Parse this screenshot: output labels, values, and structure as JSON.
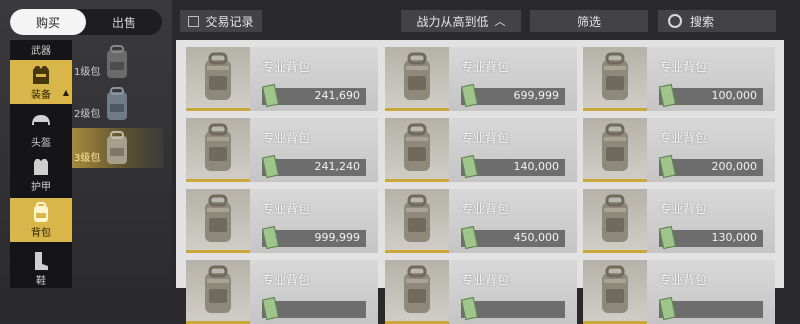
{
  "trade_tabs": [
    {
      "label": "购买",
      "active": true
    },
    {
      "label": "出售",
      "active": false
    }
  ],
  "categories": [
    {
      "label": "武器",
      "icon": "rifle-icon"
    },
    {
      "label": "装备",
      "icon": "vest-icon",
      "active": true
    },
    {
      "label": "头盔",
      "icon": "helmet-icon"
    },
    {
      "label": "护甲",
      "icon": "armor-icon"
    },
    {
      "label": "背包",
      "icon": "backpack-icon",
      "highlighted": true
    },
    {
      "label": "鞋",
      "icon": "boots-icon"
    }
  ],
  "levels": [
    {
      "label": "1级包",
      "selected": false
    },
    {
      "label": "2级包",
      "selected": false
    },
    {
      "label": "3级包",
      "selected": true
    }
  ],
  "toolbar": {
    "history_label": "交易记录",
    "sort_label": "战力从高到低",
    "filter_label": "筛选",
    "search_label": "搜索"
  },
  "items": [
    {
      "name": "专业背包",
      "price": "241,690"
    },
    {
      "name": "专业背包",
      "price": "699,999"
    },
    {
      "name": "专业背包",
      "price": "100,000"
    },
    {
      "name": "专业背包",
      "price": "241,240"
    },
    {
      "name": "专业背包",
      "price": "140,000"
    },
    {
      "name": "专业背包",
      "price": "200,000"
    },
    {
      "name": "专业背包",
      "price": "999,999"
    },
    {
      "name": "专业背包",
      "price": "450,000"
    },
    {
      "name": "专业背包",
      "price": "130,000"
    },
    {
      "name": "专业背包",
      "price": ""
    },
    {
      "name": "专业背包",
      "price": ""
    },
    {
      "name": "专业背包",
      "price": ""
    }
  ],
  "colors": {
    "accent": "#d9b64a",
    "card": "#d0d0d0",
    "price_bar": "#6d6d6d"
  }
}
